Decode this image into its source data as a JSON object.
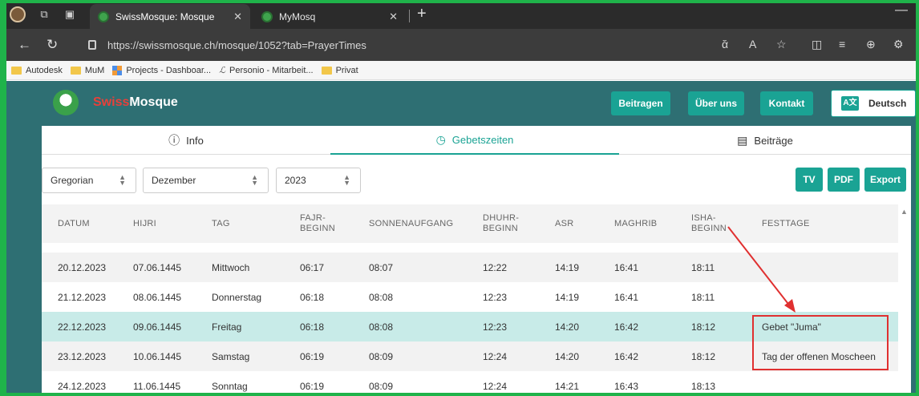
{
  "browser": {
    "tabs": [
      {
        "title": "SwissMosque: Mosque",
        "active": true
      },
      {
        "title": "MyMosq",
        "active": false
      }
    ],
    "url": "https://swissmosque.ch/mosque/1052?tab=PrayerTimes",
    "bookmarks": [
      "Autodesk",
      "MuM",
      "Projects - Dashboar...",
      "Personio - Mitarbeit...",
      "Privat"
    ]
  },
  "header": {
    "brand_part1": "Swiss",
    "brand_part2": "Mosque",
    "buttons": [
      "Beitragen",
      "Über uns",
      "Kontakt"
    ],
    "language": "Deutsch",
    "lang_icon": "A文"
  },
  "tabs": [
    {
      "label": "Info",
      "icon": "info-icon"
    },
    {
      "label": "Gebetszeiten",
      "icon": "clock-icon"
    },
    {
      "label": "Beiträge",
      "icon": "newspaper-icon"
    }
  ],
  "filters": {
    "calendar": "Gregorian",
    "month": "Dezember",
    "year": "2023"
  },
  "actions": [
    "TV",
    "PDF",
    "Export"
  ],
  "table": {
    "headers": {
      "datum": "DATUM",
      "hijri": "HIJRI",
      "tag": "TAG",
      "fajr1": "FAJR-",
      "fajr2": "BEGINN",
      "sonnenaufgang": "SONNENAUFGANG",
      "dhuhr1": "DHUHR-",
      "dhuhr2": "BEGINN",
      "asr": "ASR",
      "maghrib": "MAGHRIB",
      "isha1": "ISHA-",
      "isha2": "BEGINN",
      "festtage": "FESTTAGE"
    },
    "rows": [
      {
        "datum": "20.12.2023",
        "hijri": "07.06.1445",
        "tag": "Mittwoch",
        "fajr": "06:17",
        "sonnenaufgang": "08:07",
        "dhuhr": "12:22",
        "asr": "14:19",
        "maghrib": "16:41",
        "isha": "18:11",
        "festtage": ""
      },
      {
        "datum": "21.12.2023",
        "hijri": "08.06.1445",
        "tag": "Donnerstag",
        "fajr": "06:18",
        "sonnenaufgang": "08:08",
        "dhuhr": "12:23",
        "asr": "14:19",
        "maghrib": "16:41",
        "isha": "18:11",
        "festtage": ""
      },
      {
        "datum": "22.12.2023",
        "hijri": "09.06.1445",
        "tag": "Freitag",
        "fajr": "06:18",
        "sonnenaufgang": "08:08",
        "dhuhr": "12:23",
        "asr": "14:20",
        "maghrib": "16:42",
        "isha": "18:12",
        "festtage": "Gebet \"Juma\""
      },
      {
        "datum": "23.12.2023",
        "hijri": "10.06.1445",
        "tag": "Samstag",
        "fajr": "06:19",
        "sonnenaufgang": "08:09",
        "dhuhr": "12:24",
        "asr": "14:20",
        "maghrib": "16:42",
        "isha": "18:12",
        "festtage": "Tag der offenen Moscheen"
      },
      {
        "datum": "24.12.2023",
        "hijri": "11.06.1445",
        "tag": "Sonntag",
        "fajr": "06:19",
        "sonnenaufgang": "08:09",
        "dhuhr": "12:24",
        "asr": "14:21",
        "maghrib": "16:43",
        "isha": "18:13",
        "festtage": ""
      }
    ]
  },
  "colors": {
    "accent": "#1aa394",
    "header_bg": "#2e6f73",
    "highlight_row": "#c8ebe8",
    "annotation": "#e03030",
    "frame": "#1fb34a"
  }
}
